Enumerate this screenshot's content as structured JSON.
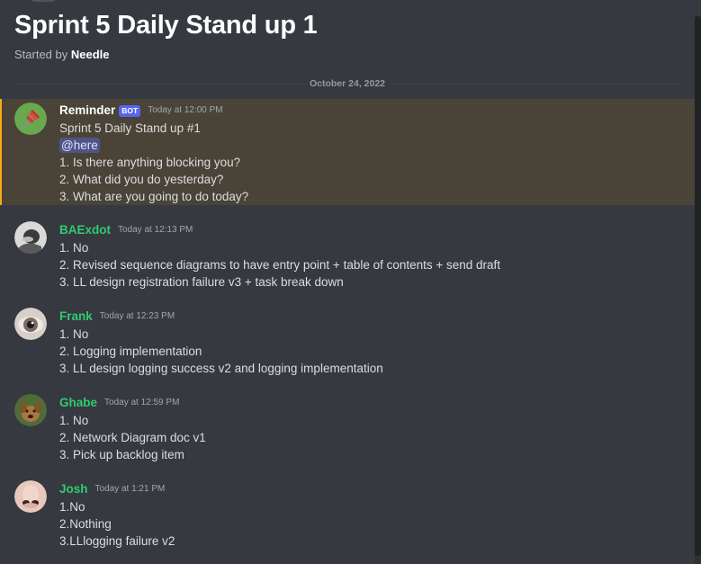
{
  "thread": {
    "title": "Sprint 5 Daily Stand up 1",
    "started_by_prefix": "Started by",
    "started_by_user": "Needle",
    "date_divider": "October 24, 2022"
  },
  "messages": [
    {
      "author": "Reminder",
      "author_color": "#ffffff",
      "bot_tag": "BOT",
      "timestamp": "Today at 12:00 PM",
      "avatar": "red-pushpin-avatar",
      "highlighted": true,
      "title_line": "Sprint 5 Daily Stand up #1",
      "mention": "@here",
      "lines": [
        "1. Is there anything blocking you?",
        "2. What did you do yesterday?",
        "3. What are you going to do today?"
      ]
    },
    {
      "author": "BAExdot",
      "author_color": "#2ecc71",
      "timestamp": "Today at 12:13 PM",
      "avatar": "person-photo-avatar",
      "lines": [
        "1. No",
        "2. Revised sequence diagrams to have entry point + table of contents + send draft",
        "3. LL design registration failure v3 + task break down"
      ]
    },
    {
      "author": "Frank",
      "author_color": "#2ecc71",
      "timestamp": "Today at 12:23 PM",
      "avatar": "eye-photo-avatar",
      "lines": [
        "1. No",
        "2. Logging implementation",
        "3. LL design logging success v2 and logging implementation"
      ]
    },
    {
      "author": "Ghabe",
      "author_color": "#2ecc71",
      "timestamp": "Today at 12:59 PM",
      "avatar": "dog-photo-avatar",
      "lines": [
        "1. No",
        "2. Network Diagram doc v1",
        "3. Pick up backlog item"
      ]
    },
    {
      "author": "Josh",
      "author_color": "#2ecc71",
      "timestamp": "Today at 1:21 PM",
      "avatar": "nose-photo-avatar",
      "lines": [
        "1.No",
        "2.Nothing",
        "3.LLlogging failure v2"
      ]
    }
  ]
}
